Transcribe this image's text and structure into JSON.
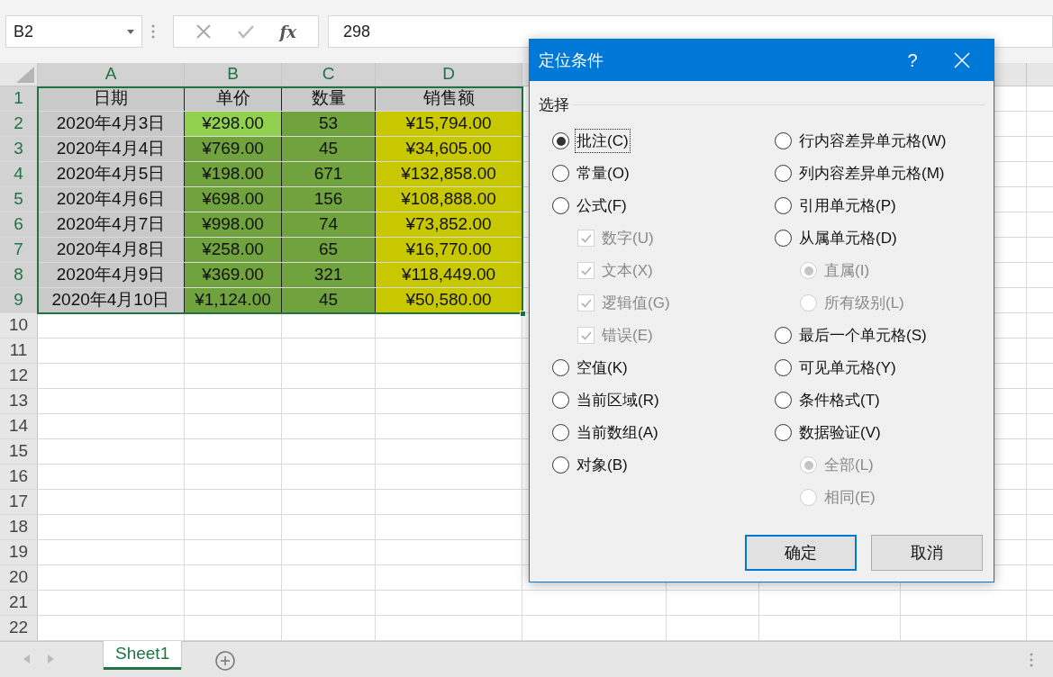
{
  "formula_bar": {
    "name_box": "B2",
    "fx": "fx",
    "value": "298"
  },
  "sheet": {
    "columns": [
      {
        "letter": "A",
        "selected": true
      },
      {
        "letter": "B",
        "selected": true
      },
      {
        "letter": "C",
        "selected": true
      },
      {
        "letter": "D",
        "selected": true
      }
    ],
    "rows": [
      {
        "number": "1",
        "selected": true,
        "cells": [
          {
            "text": "日期",
            "color": "#c9c9c9"
          },
          {
            "text": "单价",
            "color": "#c9c9c9"
          },
          {
            "text": "数量",
            "color": "#c9c9c9"
          },
          {
            "text": "销售额",
            "color": "#c9c9c9"
          }
        ]
      },
      {
        "number": "2",
        "selected": true,
        "cells": [
          {
            "text": "2020年4月3日",
            "color": "#c9c9c9"
          },
          {
            "text": "¥298.00",
            "color": "#92d050"
          },
          {
            "text": "53",
            "color": "#70a33e"
          },
          {
            "text": "¥15,794.00",
            "color": "#c8c800"
          }
        ]
      },
      {
        "number": "3",
        "selected": true,
        "cells": [
          {
            "text": "2020年4月4日",
            "color": "#c9c9c9"
          },
          {
            "text": "¥769.00",
            "color": "#70a33e"
          },
          {
            "text": "45",
            "color": "#70a33e"
          },
          {
            "text": "¥34,605.00",
            "color": "#c8c800"
          }
        ]
      },
      {
        "number": "4",
        "selected": true,
        "cells": [
          {
            "text": "2020年4月5日",
            "color": "#c9c9c9"
          },
          {
            "text": "¥198.00",
            "color": "#70a33e"
          },
          {
            "text": "671",
            "color": "#70a33e"
          },
          {
            "text": "¥132,858.00",
            "color": "#c8c800"
          }
        ]
      },
      {
        "number": "5",
        "selected": true,
        "cells": [
          {
            "text": "2020年4月6日",
            "color": "#c9c9c9"
          },
          {
            "text": "¥698.00",
            "color": "#70a33e"
          },
          {
            "text": "156",
            "color": "#70a33e"
          },
          {
            "text": "¥108,888.00",
            "color": "#c8c800"
          }
        ]
      },
      {
        "number": "6",
        "selected": true,
        "cells": [
          {
            "text": "2020年4月7日",
            "color": "#c9c9c9"
          },
          {
            "text": "¥998.00",
            "color": "#70a33e"
          },
          {
            "text": "74",
            "color": "#70a33e"
          },
          {
            "text": "¥73,852.00",
            "color": "#c8c800"
          }
        ]
      },
      {
        "number": "7",
        "selected": true,
        "cells": [
          {
            "text": "2020年4月8日",
            "color": "#c9c9c9"
          },
          {
            "text": "¥258.00",
            "color": "#70a33e"
          },
          {
            "text": "65",
            "color": "#70a33e"
          },
          {
            "text": "¥16,770.00",
            "color": "#c8c800"
          }
        ]
      },
      {
        "number": "8",
        "selected": true,
        "cells": [
          {
            "text": "2020年4月9日",
            "color": "#c9c9c9"
          },
          {
            "text": "¥369.00",
            "color": "#70a33e"
          },
          {
            "text": "321",
            "color": "#70a33e"
          },
          {
            "text": "¥118,449.00",
            "color": "#c8c800"
          }
        ]
      },
      {
        "number": "9",
        "selected": true,
        "cells": [
          {
            "text": "2020年4月10日",
            "color": "#c9c9c9"
          },
          {
            "text": "¥1,124.00",
            "color": "#70a33e"
          },
          {
            "text": "45",
            "color": "#70a33e"
          },
          {
            "text": "¥50,580.00",
            "color": "#c8c800"
          }
        ]
      },
      {
        "number": "10",
        "selected": false,
        "cells": []
      },
      {
        "number": "11",
        "selected": false,
        "cells": []
      },
      {
        "number": "12",
        "selected": false,
        "cells": []
      },
      {
        "number": "13",
        "selected": false,
        "cells": []
      },
      {
        "number": "14",
        "selected": false,
        "cells": []
      },
      {
        "number": "15",
        "selected": false,
        "cells": []
      },
      {
        "number": "16",
        "selected": false,
        "cells": []
      },
      {
        "number": "17",
        "selected": false,
        "cells": []
      },
      {
        "number": "18",
        "selected": false,
        "cells": []
      },
      {
        "number": "19",
        "selected": false,
        "cells": []
      },
      {
        "number": "20",
        "selected": false,
        "cells": []
      },
      {
        "number": "21",
        "selected": false,
        "cells": []
      },
      {
        "number": "22",
        "selected": false,
        "cells": []
      }
    ]
  },
  "sheet_tabs": [
    {
      "label": "Sheet1",
      "selected": true
    }
  ],
  "dialog": {
    "title": "定位条件",
    "help": "?",
    "group_label": "选择",
    "left_options": [
      {
        "kind": "radio",
        "label": "批注(C)",
        "selected": true,
        "disabled": false,
        "focused": true
      },
      {
        "kind": "radio",
        "label": "常量(O)",
        "selected": false,
        "disabled": false,
        "focused": false
      },
      {
        "kind": "radio",
        "label": "公式(F)",
        "selected": false,
        "disabled": false,
        "focused": false,
        "children": [
          {
            "kind": "checkbox",
            "label": "数字(U)",
            "checked": true,
            "disabled": true
          },
          {
            "kind": "checkbox",
            "label": "文本(X)",
            "checked": true,
            "disabled": true
          },
          {
            "kind": "checkbox",
            "label": "逻辑值(G)",
            "checked": true,
            "disabled": true
          },
          {
            "kind": "checkbox",
            "label": "错误(E)",
            "checked": true,
            "disabled": true
          }
        ]
      },
      {
        "kind": "radio",
        "label": "空值(K)",
        "selected": false,
        "disabled": false,
        "focused": false
      },
      {
        "kind": "radio",
        "label": "当前区域(R)",
        "selected": false,
        "disabled": false,
        "focused": false
      },
      {
        "kind": "radio",
        "label": "当前数组(A)",
        "selected": false,
        "disabled": false,
        "focused": false
      },
      {
        "kind": "radio",
        "label": "对象(B)",
        "selected": false,
        "disabled": false,
        "focused": false
      }
    ],
    "right_options": [
      {
        "kind": "radio",
        "label": "行内容差异单元格(W)",
        "selected": false,
        "disabled": false,
        "focused": false
      },
      {
        "kind": "radio",
        "label": "列内容差异单元格(M)",
        "selected": false,
        "disabled": false,
        "focused": false
      },
      {
        "kind": "radio",
        "label": "引用单元格(P)",
        "selected": false,
        "disabled": false,
        "focused": false
      },
      {
        "kind": "radio",
        "label": "从属单元格(D)",
        "selected": false,
        "disabled": false,
        "focused": false,
        "children": [
          {
            "kind": "radio",
            "label": "直属(I)",
            "selected": true,
            "disabled": true,
            "focused": false
          },
          {
            "kind": "radio",
            "label": "所有级别(L)",
            "selected": false,
            "disabled": true,
            "focused": false
          }
        ]
      },
      {
        "kind": "radio",
        "label": "最后一个单元格(S)",
        "selected": false,
        "disabled": false,
        "focused": false
      },
      {
        "kind": "radio",
        "label": "可见单元格(Y)",
        "selected": false,
        "disabled": false,
        "focused": false
      },
      {
        "kind": "radio",
        "label": "条件格式(T)",
        "selected": false,
        "disabled": false,
        "focused": false
      },
      {
        "kind": "radio",
        "label": "数据验证(V)",
        "selected": false,
        "disabled": false,
        "focused": false,
        "children": [
          {
            "kind": "radio",
            "label": "全部(L)",
            "selected": true,
            "disabled": true,
            "focused": false
          },
          {
            "kind": "radio",
            "label": "相同(E)",
            "selected": false,
            "disabled": true,
            "focused": false
          }
        ]
      }
    ],
    "buttons": [
      {
        "label": "确定",
        "default": true
      },
      {
        "label": "取消",
        "default": false
      }
    ]
  }
}
